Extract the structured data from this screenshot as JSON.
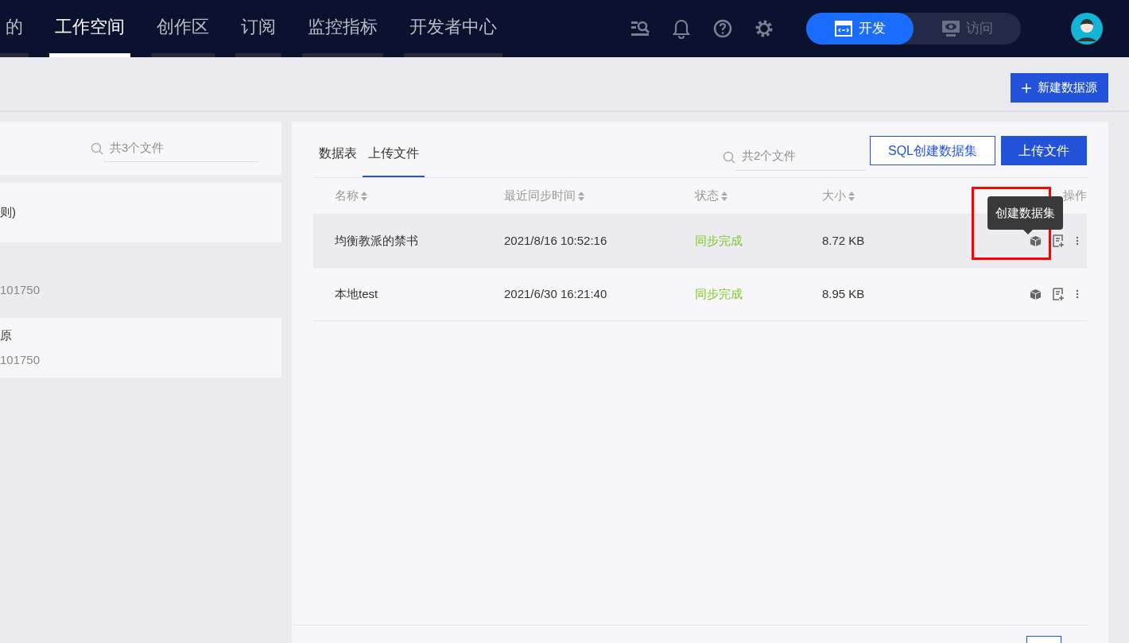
{
  "nav": {
    "tabs": [
      {
        "label": "的",
        "selected": false
      },
      {
        "label": "工作空间",
        "selected": true
      },
      {
        "label": "创作区",
        "selected": false
      },
      {
        "label": "订阅",
        "selected": false
      },
      {
        "label": "监控指标",
        "selected": false
      },
      {
        "label": "开发者中心",
        "selected": false
      }
    ],
    "mode_toggle": [
      {
        "label": "开发",
        "selected": true
      },
      {
        "label": "访问",
        "selected": false
      }
    ]
  },
  "toolbar": {
    "new_button": "新建数据源"
  },
  "left_panel": {
    "search": {
      "placeholder": "共3个文件"
    },
    "items": [
      {
        "title": "则)",
        "selected": false
      },
      {
        "subtitle": "101750",
        "selected": true
      },
      {
        "title": "原",
        "subtitle": "101750",
        "selected": false
      }
    ]
  },
  "right_panel": {
    "tabs": [
      {
        "label": "数据表",
        "selected": false
      },
      {
        "label": "上传文件",
        "selected": true
      }
    ],
    "search": {
      "placeholder": "共2个文件"
    },
    "buttons": [
      {
        "label": "SQL创建数据集",
        "kind": "outline"
      },
      {
        "label": "上传文件",
        "kind": "primary"
      }
    ],
    "table": {
      "columns": [
        {
          "label": "名称",
          "sortable": true
        },
        {
          "label": "最近同步时间",
          "sortable": true
        },
        {
          "label": "状态",
          "sortable": true
        },
        {
          "label": "大小",
          "sortable": true
        },
        {
          "label": "操作",
          "sortable": false
        }
      ],
      "rows": [
        {
          "name": "均衡教派的禁书",
          "time": "2021/8/16 10:52:16",
          "status": "同步完成",
          "size": "8.72 KB",
          "hovered": true
        },
        {
          "name": "本地test",
          "time": "2021/6/30 16:21:40",
          "status": "同步完成",
          "size": "8.95 KB",
          "hovered": false
        }
      ]
    },
    "tooltip": "创建数据集"
  }
}
